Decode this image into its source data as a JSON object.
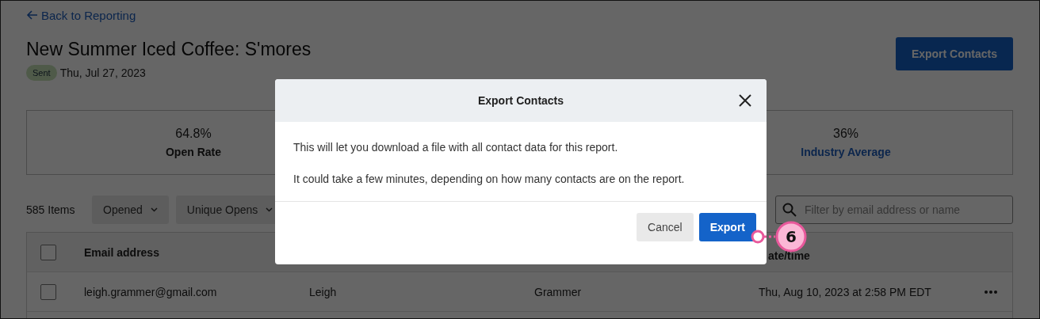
{
  "back_link": "Back to Reporting",
  "title": "New Summer Iced Coffee: S'mores",
  "status_badge": "Sent",
  "sent_date": "Thu, Jul 27, 2023",
  "export_button": "Export Contacts",
  "metrics": [
    {
      "value": "64.8%",
      "label": "Open Rate",
      "kind": "plain"
    },
    {
      "value": "36%",
      "label": "Industry Average",
      "kind": "link"
    }
  ],
  "toolbar": {
    "count": "585 Items",
    "filters": [
      "Opened",
      "Unique Opens"
    ],
    "search": {
      "placeholder": "Filter by email address or name"
    }
  },
  "table": {
    "select_all": {
      "checked": false
    },
    "columns": [
      "Email address",
      "",
      "",
      "ate/time"
    ],
    "rows": [
      {
        "selected": false,
        "cells": [
          "leigh.grammer@gmail.com",
          "Leigh",
          "Grammer",
          "Thu, Aug 10, 2023 at 2:58 PM EDT"
        ]
      }
    ]
  },
  "dialog": {
    "title": "Export Contacts",
    "paragraphs": [
      "This will let you download a file with all contact data for this report.",
      "It could take a few minutes, depending on how many contacts are on the report."
    ],
    "buttons": [
      {
        "label": "Cancel",
        "kind": "secondary"
      },
      {
        "label": "Export",
        "kind": "primary"
      }
    ]
  },
  "callout": {
    "number": "6"
  }
}
